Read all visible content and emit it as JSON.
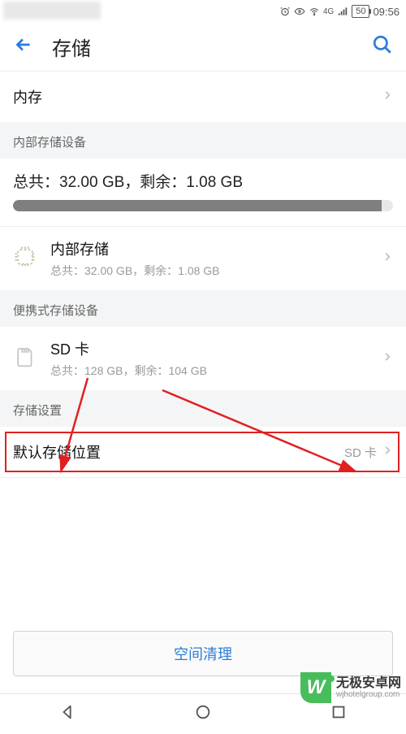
{
  "status": {
    "battery": "50",
    "time": "09:56",
    "network_label": "4G"
  },
  "header": {
    "title": "存储"
  },
  "memory": {
    "label": "内存"
  },
  "internal_section": {
    "header": "内部存储设备",
    "summary": "总共：32.00 GB，剩余：1.08 GB",
    "item_title": "内部存储",
    "item_sub": "总共：32.00 GB，剩余：1.08 GB"
  },
  "portable_section": {
    "header": "便携式存储设备",
    "item_title": "SD 卡",
    "item_sub": "总共：128 GB，剩余：104 GB"
  },
  "settings_section": {
    "header": "存储设置",
    "default_label": "默认存储位置",
    "default_value": "SD 卡"
  },
  "clean_button": "空间清理",
  "watermark": {
    "cn": "无极安卓网",
    "en": "wjhotelgroup.com"
  }
}
